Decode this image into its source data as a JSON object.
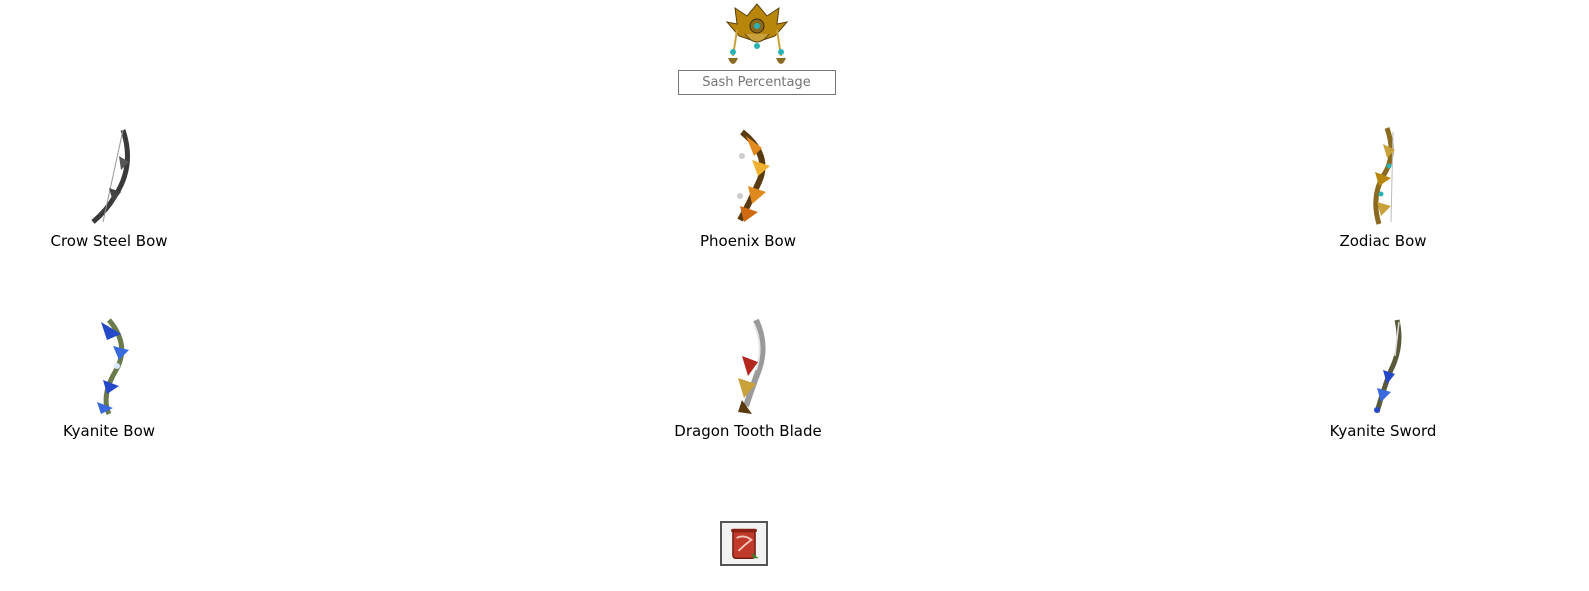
{
  "sash": {
    "icon": "ornate-sash-icon",
    "input_placeholder": "Sash Percentage",
    "input_value": ""
  },
  "items": [
    {
      "label": "Crow Steel Bow",
      "icon": "crow-steel-bow-icon"
    },
    {
      "label": "Phoenix Bow",
      "icon": "phoenix-bow-icon"
    },
    {
      "label": "Zodiac Bow",
      "icon": "zodiac-bow-icon"
    },
    {
      "label": "Kyanite Bow",
      "icon": "kyanite-bow-icon"
    },
    {
      "label": "Dragon Tooth Blade",
      "icon": "dragon-tooth-blade-icon"
    },
    {
      "label": "Kyanite Sword",
      "icon": "kyanite-sword-icon"
    }
  ],
  "bottom_button": {
    "icon": "red-scroll-icon"
  },
  "colors": {
    "gold": "#b8860b",
    "teal_gem": "#2bb3b3",
    "dark_steel": "#3a3a3a",
    "phoenix_orange": "#e08a1e",
    "kyanite_blue": "#2548c8",
    "dragon_red": "#b3261e",
    "scroll_red": "#c0392b"
  }
}
